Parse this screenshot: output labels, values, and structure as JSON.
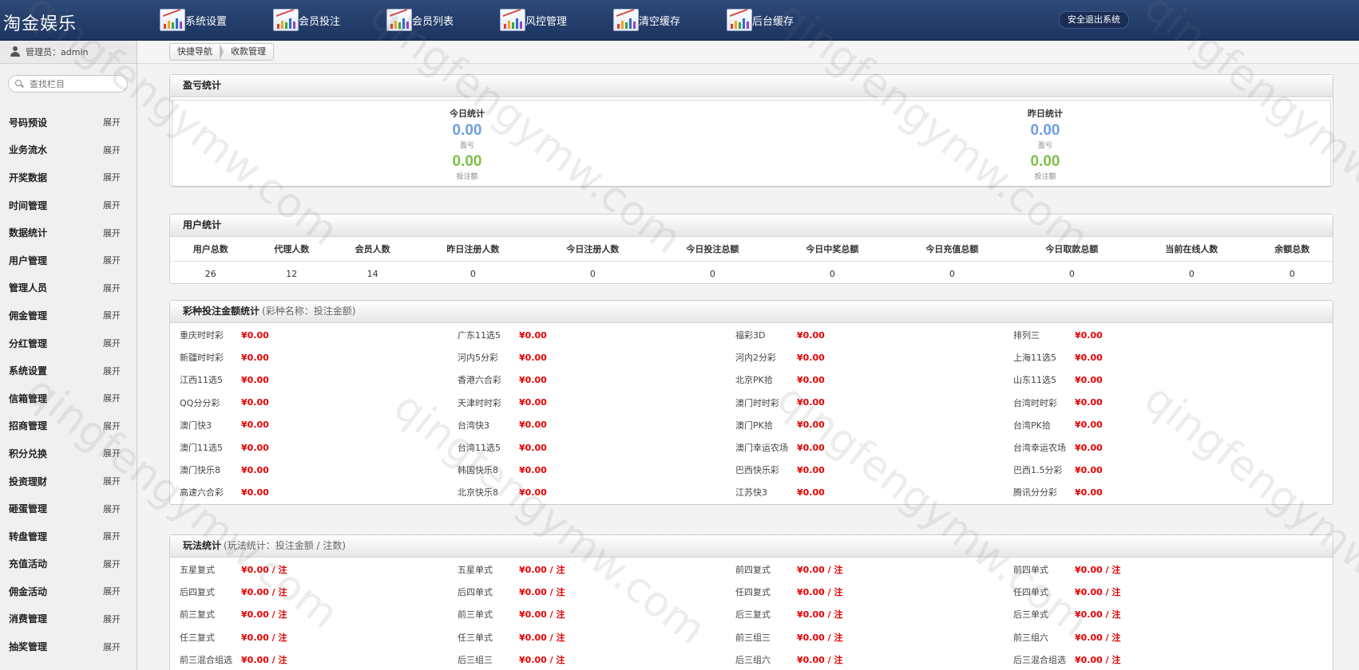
{
  "app": {
    "title": "淘金娱乐"
  },
  "nav": [
    {
      "label": "系统设置"
    },
    {
      "label": "会员投注"
    },
    {
      "label": "会员列表"
    },
    {
      "label": "风控管理"
    },
    {
      "label": "清空缓存"
    },
    {
      "label": "后台缓存"
    }
  ],
  "logout_label": "安全退出系统",
  "sidebar": {
    "admin_label": "管理员：admin",
    "search_placeholder": "查找栏目",
    "expand_label": "展开",
    "items": [
      {
        "label": "号码预设"
      },
      {
        "label": "业务流水"
      },
      {
        "label": "开奖数据"
      },
      {
        "label": "时间管理"
      },
      {
        "label": "数据统计"
      },
      {
        "label": "用户管理"
      },
      {
        "label": "管理人员"
      },
      {
        "label": "佣金管理"
      },
      {
        "label": "分红管理"
      },
      {
        "label": "系统设置"
      },
      {
        "label": "信箱管理"
      },
      {
        "label": "招商管理"
      },
      {
        "label": "积分兑换"
      },
      {
        "label": "投资理财"
      },
      {
        "label": "砸蛋管理"
      },
      {
        "label": "转盘管理"
      },
      {
        "label": "充值活动"
      },
      {
        "label": "佣金活动"
      },
      {
        "label": "消费管理"
      },
      {
        "label": "抽奖管理"
      }
    ]
  },
  "breadcrumb": {
    "home": "快捷导航",
    "current": "收款管理"
  },
  "profit": {
    "title": "盈亏统计",
    "today": {
      "title": "今日统计",
      "profit": "0.00",
      "profit_label": "盈亏",
      "bet": "0.00",
      "bet_label": "投注额"
    },
    "yesterday": {
      "title": "昨日统计",
      "profit": "0.00",
      "profit_label": "盈亏",
      "bet": "0.00",
      "bet_label": "投注额"
    }
  },
  "users": {
    "title": "用户统计",
    "columns": [
      "用户总数",
      "代理人数",
      "会员人数",
      "昨日注册人数",
      "今日注册人数",
      "今日投注总额",
      "今日中奖总额",
      "今日充值总额",
      "今日取款总额",
      "当前在线人数",
      "余额总数"
    ],
    "values": [
      "26",
      "12",
      "14",
      "0",
      "0",
      "0",
      "0",
      "0",
      "0",
      "0",
      "0"
    ]
  },
  "lottery": {
    "title": "彩种投注金额统计",
    "subtitle": "(彩种名称：投注金额)",
    "items": [
      {
        "name": "重庆时时彩",
        "amount": "¥0.00"
      },
      {
        "name": "广东11选5",
        "amount": "¥0.00"
      },
      {
        "name": "福彩3D",
        "amount": "¥0.00"
      },
      {
        "name": "排列三",
        "amount": "¥0.00"
      },
      {
        "name": "新疆时时彩",
        "amount": "¥0.00"
      },
      {
        "name": "河内5分彩",
        "amount": "¥0.00"
      },
      {
        "name": "河内2分彩",
        "amount": "¥0.00"
      },
      {
        "name": "上海11选5",
        "amount": "¥0.00"
      },
      {
        "name": "江西11选5",
        "amount": "¥0.00"
      },
      {
        "name": "香港六合彩",
        "amount": "¥0.00"
      },
      {
        "name": "北京PK拾",
        "amount": "¥0.00"
      },
      {
        "name": "山东11选5",
        "amount": "¥0.00"
      },
      {
        "name": "QQ分分彩",
        "amount": "¥0.00"
      },
      {
        "name": "天津时时彩",
        "amount": "¥0.00"
      },
      {
        "name": "澳门时时彩",
        "amount": "¥0.00"
      },
      {
        "name": "台湾时时彩",
        "amount": "¥0.00"
      },
      {
        "name": "澳门快3",
        "amount": "¥0.00"
      },
      {
        "name": "台湾快3",
        "amount": "¥0.00"
      },
      {
        "name": "澳门PK拾",
        "amount": "¥0.00"
      },
      {
        "name": "台湾PK拾",
        "amount": "¥0.00"
      },
      {
        "name": "澳门11选5",
        "amount": "¥0.00"
      },
      {
        "name": "台湾11选5",
        "amount": "¥0.00"
      },
      {
        "name": "澳门幸运农场",
        "amount": "¥0.00"
      },
      {
        "name": "台湾幸运农场",
        "amount": "¥0.00"
      },
      {
        "name": "澳门快乐8",
        "amount": "¥0.00"
      },
      {
        "name": "韩国快乐8",
        "amount": "¥0.00"
      },
      {
        "name": "巴西快乐彩",
        "amount": "¥0.00"
      },
      {
        "name": "巴西1.5分彩",
        "amount": "¥0.00"
      },
      {
        "name": "高速六合彩",
        "amount": "¥0.00"
      },
      {
        "name": "北京快乐8",
        "amount": "¥0.00"
      },
      {
        "name": "江苏快3",
        "amount": "¥0.00"
      },
      {
        "name": "腾讯分分彩",
        "amount": "¥0.00"
      }
    ]
  },
  "playtypes": {
    "title": "玩法统计",
    "subtitle": "(玩法统计：投注金额 / 注数)",
    "items": [
      {
        "name": "五星复式",
        "amount": "¥0.00 / 注"
      },
      {
        "name": "五星单式",
        "amount": "¥0.00 / 注"
      },
      {
        "name": "前四复式",
        "amount": "¥0.00 / 注"
      },
      {
        "name": "前四单式",
        "amount": "¥0.00 / 注"
      },
      {
        "name": "后四复式",
        "amount": "¥0.00 / 注"
      },
      {
        "name": "后四单式",
        "amount": "¥0.00 / 注"
      },
      {
        "name": "任四复式",
        "amount": "¥0.00 / 注"
      },
      {
        "name": "任四单式",
        "amount": "¥0.00 / 注"
      },
      {
        "name": "前三复式",
        "amount": "¥0.00 / 注"
      },
      {
        "name": "前三单式",
        "amount": "¥0.00 / 注"
      },
      {
        "name": "后三复式",
        "amount": "¥0.00 / 注"
      },
      {
        "name": "后三单式",
        "amount": "¥0.00 / 注"
      },
      {
        "name": "任三复式",
        "amount": "¥0.00 / 注"
      },
      {
        "name": "任三单式",
        "amount": "¥0.00 / 注"
      },
      {
        "name": "前三组三",
        "amount": "¥0.00 / 注"
      },
      {
        "name": "前三组六",
        "amount": "¥0.00 / 注"
      },
      {
        "name": "前三混合组选",
        "amount": "¥0.00 / 注"
      },
      {
        "name": "后三组三",
        "amount": "¥0.00 / 注"
      },
      {
        "name": "后三组六",
        "amount": "¥0.00 / 注"
      },
      {
        "name": "后三混合组选",
        "amount": "¥0.00 / 注"
      }
    ]
  },
  "watermark": "qingfengymw.com",
  "colors": {
    "header": "#2e4a78",
    "money": "#e60000",
    "profit": "#6f9ee0",
    "bet": "#7cc04a"
  }
}
